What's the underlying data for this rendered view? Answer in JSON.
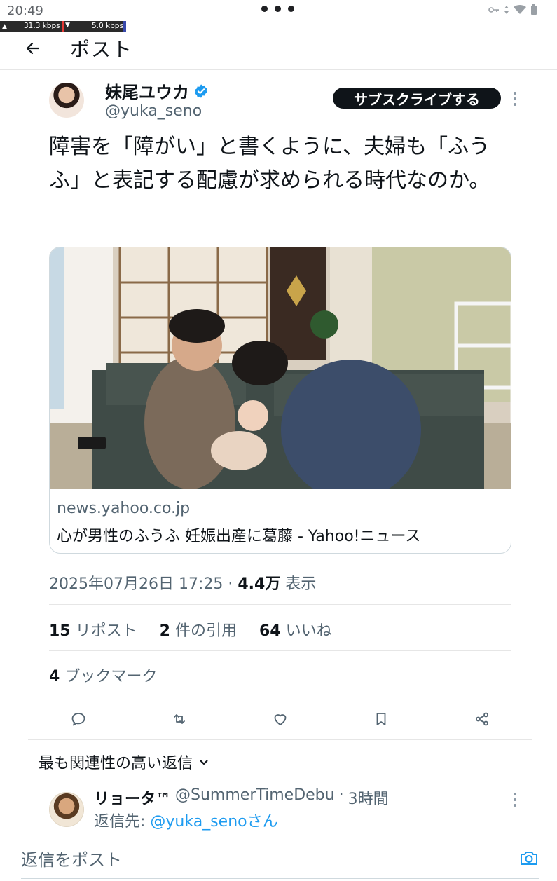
{
  "status_bar": {
    "time": "20:49",
    "net_up": "31.3 kbps",
    "net_down": "5.0 kbps"
  },
  "header": {
    "title": "ポスト"
  },
  "tweet": {
    "author_name": "妹尾ユウカ",
    "author_handle": "@yuka_seno",
    "subscribe_label": "サブスクライブする",
    "text": "障害を「障がい」と書くように、夫婦も「ふうふ」と表記する配慮が求められる時代なのか。",
    "card": {
      "domain": "news.yahoo.co.jp",
      "title": "心が男性のふうふ 妊娠出産に葛藤 - Yahoo!ニュース"
    },
    "timestamp": "2025年07月26日 17:25",
    "views_count": "4.4万",
    "views_label": "表示",
    "stats": {
      "reposts_count": "15",
      "reposts_label": "リポスト",
      "quotes_count": "2",
      "quotes_label": "件の引用",
      "likes_count": "64",
      "likes_label": "いいね",
      "bookmarks_count": "4",
      "bookmarks_label": "ブックマーク"
    }
  },
  "replies": {
    "sort_label": "最も関連性の高い返信",
    "items": [
      {
        "name": "リョータ™",
        "handle": "@SummerTimeDebu",
        "time": "3時間",
        "reply_to_prefix": "返信先: ",
        "reply_to_handle": "@yuka_seno",
        "reply_to_suffix": "さん"
      }
    ]
  },
  "compose": {
    "placeholder": "返信をポスト"
  },
  "colors": {
    "accent": "#1d9bf0",
    "text": "#0f1419",
    "secondary": "#536471"
  }
}
